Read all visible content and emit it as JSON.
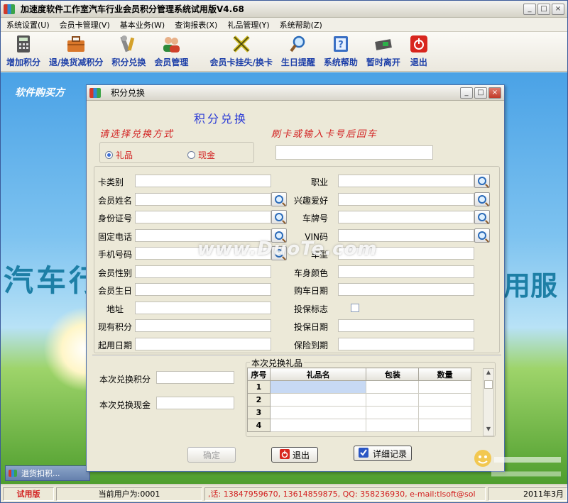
{
  "app": {
    "title": "加速度软件工作室汽车行业会员积分管理系统试用版V4.68",
    "menu": [
      "系统设置(U)",
      "会员卡管理(V)",
      "基本业务(W)",
      "查询报表(X)",
      "礼品管理(Y)",
      "系统帮助(Z)"
    ],
    "toolbar": [
      {
        "label": "增加积分",
        "icon": "calculator-icon"
      },
      {
        "label": "退/换货减积分",
        "icon": "briefcase-icon"
      },
      {
        "label": "积分兑换",
        "icon": "tools-icon"
      },
      {
        "label": "会员管理",
        "icon": "users-icon"
      },
      {
        "label": "会员卡挂失/换卡",
        "icon": "card-swap-icon"
      },
      {
        "label": "生日提醒",
        "icon": "magnifier-icon"
      },
      {
        "label": "系统帮助",
        "icon": "help-icon"
      },
      {
        "label": "暂时离开",
        "icon": "lock-icon"
      },
      {
        "label": "退出",
        "icon": "power-icon"
      }
    ]
  },
  "desktop": {
    "banner": "软件购买方",
    "big_left": "汽车行",
    "big_right": "用服",
    "minimized": "退货扣积..."
  },
  "dialog": {
    "title": "积分兑换",
    "heading": "积分兑换",
    "choose_label": "请选择兑换方式",
    "swipe_label": "刷卡或输入卡号后回车",
    "radio_gift": "礼品",
    "radio_cash": "现金",
    "fields_left": [
      "卡类别",
      "会员姓名",
      "身份证号",
      "固定电话",
      "手机号码",
      "会员性别",
      "会员生日",
      "地址",
      "现有积分",
      "起用日期"
    ],
    "fields_right": [
      "职业",
      "兴趣爱好",
      "车牌号",
      "VIN码",
      "车型",
      "车身颜色",
      "购车日期",
      "投保标志",
      "投保日期",
      "保险到期"
    ],
    "redeem_points_label": "本次兑换积分",
    "redeem_cash_label": "本次兑换现金",
    "gifts_group": "本次兑换礼品",
    "table_headers": [
      "序号",
      "礼品名",
      "包装",
      "数量"
    ],
    "table_rows": [
      "1",
      "2",
      "3",
      "4"
    ],
    "btn_ok": "确定",
    "btn_exit": "退出",
    "btn_detail": "详细记录"
  },
  "watermark": "www.DuoTe.com",
  "status": {
    "trial": "试用版",
    "user": "当前用户为:0001",
    "contact": ",话: 13847959670, 13614859875, QQ: 358236930, e-mail:tlsoft@sol",
    "date": "2011年3月"
  },
  "colors": {
    "accent": "#1d3fa8",
    "red": "#d22020",
    "heading": "#2a3ad6"
  }
}
